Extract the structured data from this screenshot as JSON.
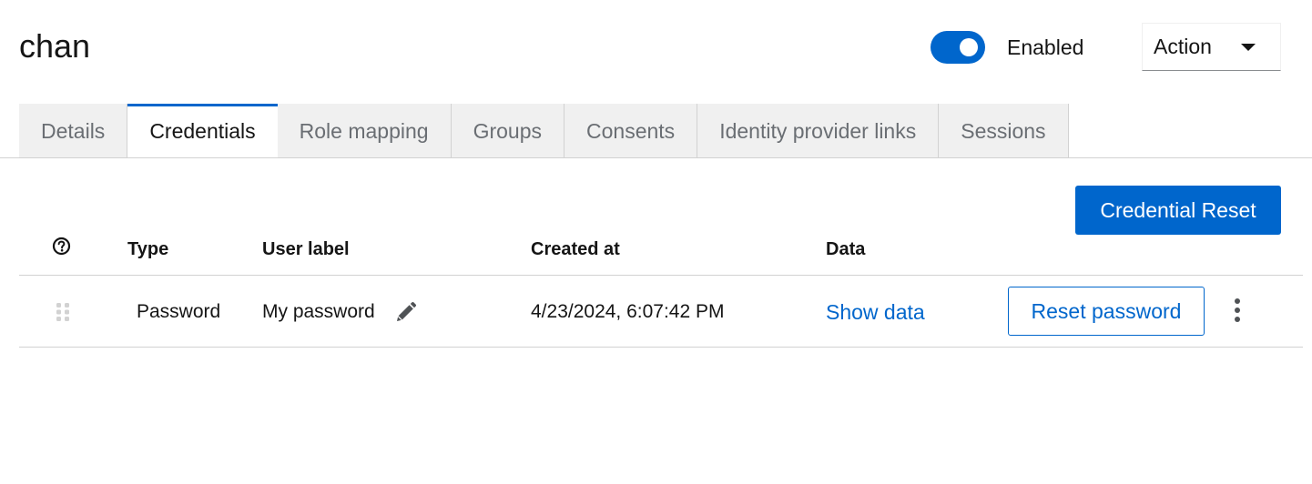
{
  "header": {
    "title": "chan",
    "enabled_label": "Enabled",
    "enabled": true,
    "action_label": "Action"
  },
  "tabs": [
    {
      "label": "Details",
      "active": false
    },
    {
      "label": "Credentials",
      "active": true
    },
    {
      "label": "Role mapping",
      "active": false
    },
    {
      "label": "Groups",
      "active": false
    },
    {
      "label": "Consents",
      "active": false
    },
    {
      "label": "Identity provider links",
      "active": false
    },
    {
      "label": "Sessions",
      "active": false
    }
  ],
  "toolbar": {
    "credential_reset_label": "Credential Reset"
  },
  "table": {
    "headers": {
      "type": "Type",
      "user_label": "User label",
      "created_at": "Created at",
      "data": "Data"
    },
    "rows": [
      {
        "type": "Password",
        "user_label": "My password",
        "created_at": "4/23/2024, 6:07:42 PM",
        "data_link": "Show data",
        "reset_label": "Reset password"
      }
    ]
  },
  "icons": {
    "help": "help-circle-icon",
    "drag": "drag-handle-icon",
    "edit": "pencil-icon",
    "kebab": "kebab-menu-icon"
  },
  "colors": {
    "accent": "#0066cc",
    "tab_bg": "#f0f0f0",
    "border": "#d2d2d2"
  }
}
